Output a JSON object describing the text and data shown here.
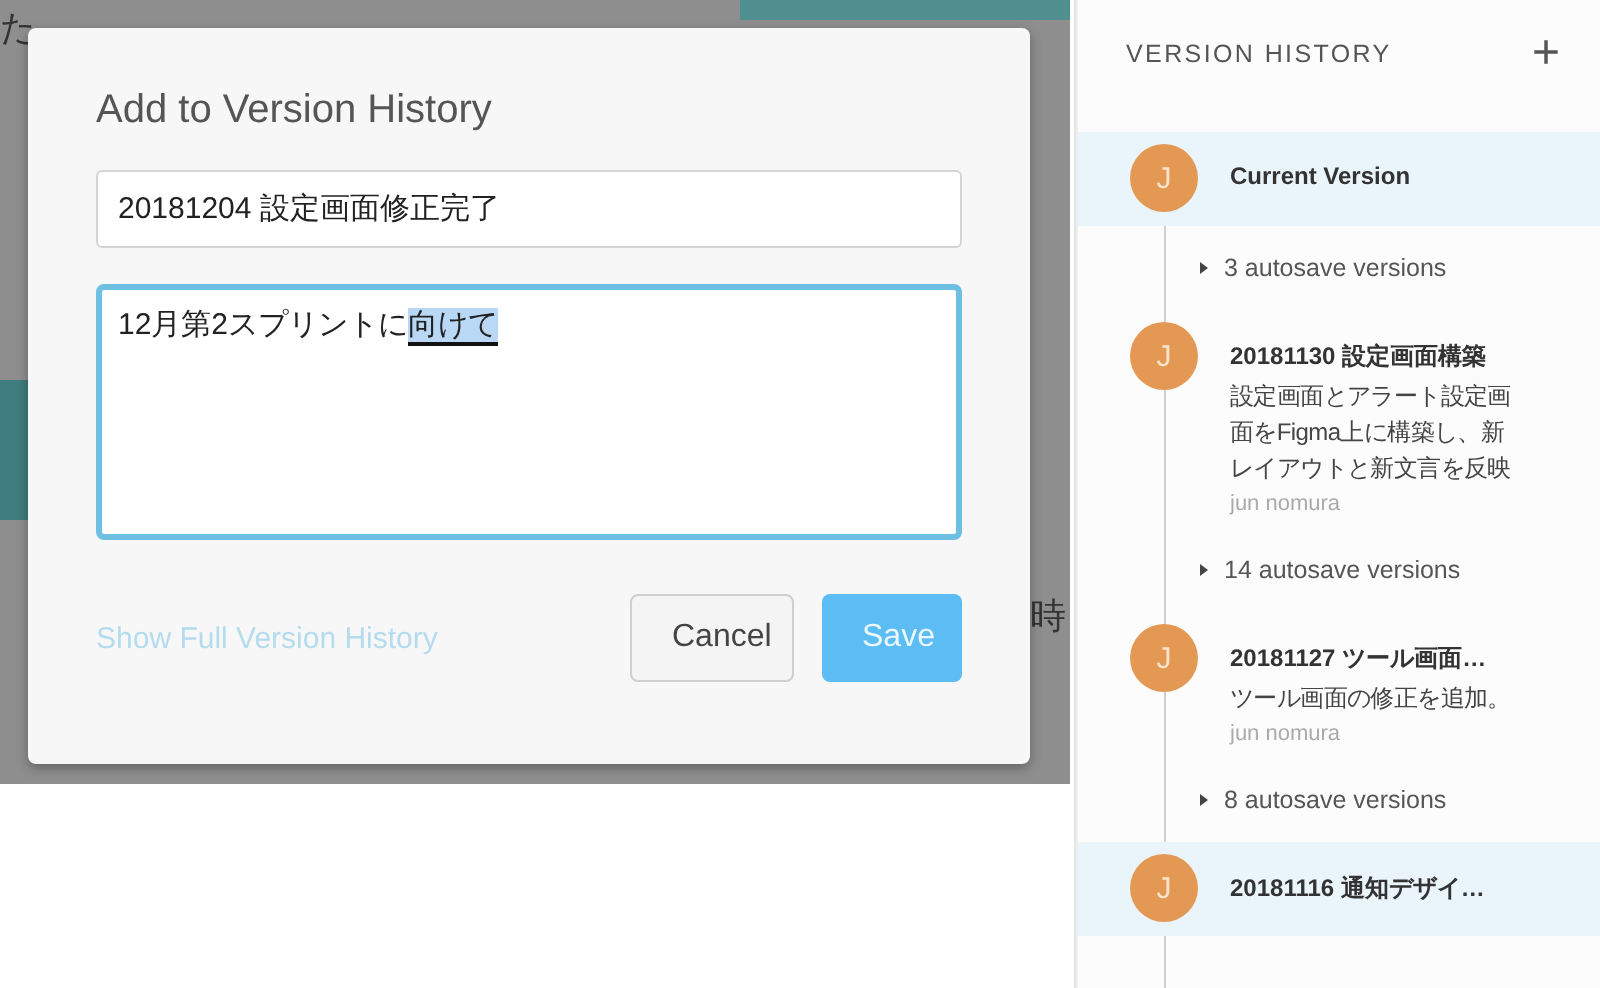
{
  "background": {
    "texts": [
      "た",
      "時"
    ]
  },
  "dialog": {
    "title": "Add to Version History",
    "name_field": {
      "value": "20181204 設定画面修正完了"
    },
    "notes_field": {
      "value": "12月第2スプリントに",
      "selected_text": "向けて"
    },
    "link": "Show Full Version History",
    "buttons": [
      {
        "label": "Cancel",
        "kind": "secondary"
      },
      {
        "label": "Save",
        "kind": "primary"
      }
    ]
  },
  "sidebar": {
    "title": "VERSION HISTORY",
    "add": "+",
    "items": [
      {
        "kind": "version",
        "avatar": "J",
        "title": "Current Version",
        "selected": true
      },
      {
        "kind": "autosave",
        "label": "3 autosave versions"
      },
      {
        "kind": "version",
        "avatar": "J",
        "title": "20181130 設定画面構築",
        "description": "設定画面とアラート設定画面をFigma上に構築し、新レイアウトと新文言を反映",
        "author": "jun nomura",
        "selected": false
      },
      {
        "kind": "autosave",
        "label": "14 autosave versions"
      },
      {
        "kind": "version",
        "avatar": "J",
        "title": "20181127 ツール画面…",
        "description": "ツール画面の修正を追加。",
        "author": "jun nomura",
        "selected": false
      },
      {
        "kind": "autosave",
        "label": "8 autosave versions"
      },
      {
        "kind": "version",
        "avatar": "J",
        "title": "20181116 通知デザイ…",
        "selected": true
      }
    ]
  }
}
